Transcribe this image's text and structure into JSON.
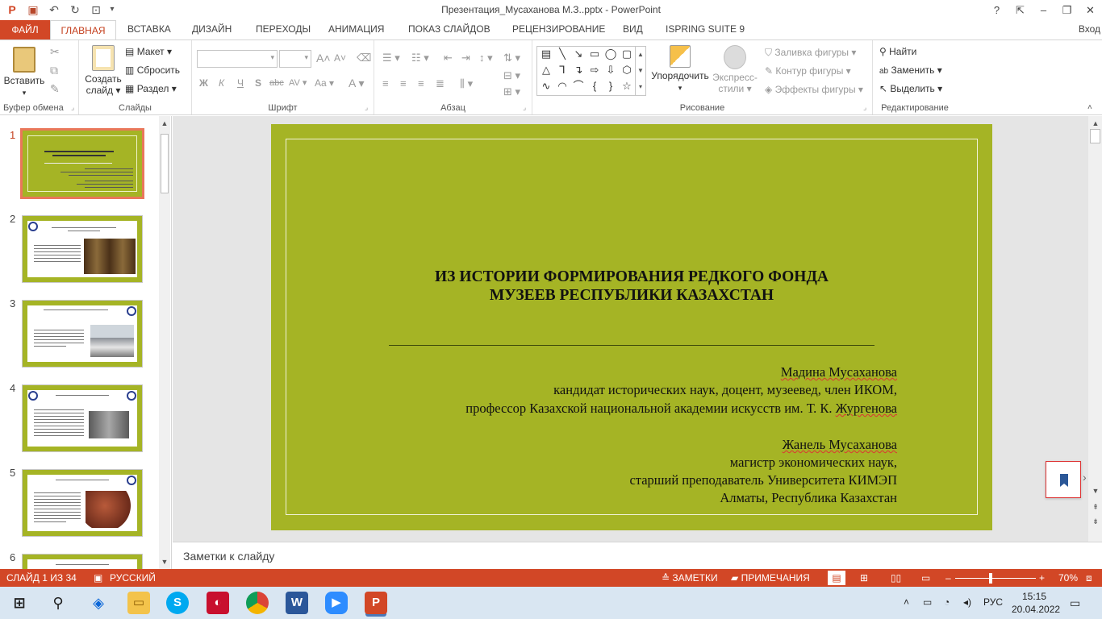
{
  "window": {
    "title": "Презентация_Мусаханова М.З..pptx - PowerPoint",
    "help": "?",
    "controls": [
      "–",
      "❐",
      "✕"
    ]
  },
  "tabs": {
    "file": "ФАЙЛ",
    "active": "ГЛАВНАЯ",
    "others": [
      "ВСТАВКА",
      "ДИЗАЙН",
      "ПЕРЕХОДЫ",
      "АНИМАЦИЯ",
      "ПОКАЗ СЛАЙДОВ",
      "РЕЦЕНЗИРОВАНИЕ",
      "ВИД",
      "ISPRING SUITE 9"
    ],
    "login": "Вход"
  },
  "ribbon": {
    "clipboard": {
      "label": "Буфер обмена",
      "paste": "Вставить"
    },
    "slides": {
      "label": "Слайды",
      "new_slide_1": "Создать",
      "new_slide_2": "слайд",
      "layout": "Макет",
      "reset": "Сбросить",
      "section": "Раздел"
    },
    "font": {
      "label": "Шрифт",
      "bold": "Ж",
      "italic": "К",
      "underline": "Ч",
      "shadow": "S",
      "strike": "abc",
      "spacing": "AV",
      "case": "Aa",
      "grow": "A",
      "shrink": "A",
      "color": "A"
    },
    "paragraph": {
      "label": "Абзац"
    },
    "drawing": {
      "label": "Рисование",
      "arrange": "Упорядочить",
      "styles_1": "Экспресс-",
      "styles_2": "стили",
      "fill": "Заливка фигуры",
      "outline": "Контур фигуры",
      "effects": "Эффекты фигуры"
    },
    "editing": {
      "label": "Редактирование",
      "find": "Найти",
      "replace": "Заменить",
      "select": "Выделить"
    }
  },
  "thumbnails": {
    "numbers": [
      "1",
      "2",
      "3",
      "4",
      "5",
      "6"
    ]
  },
  "slide": {
    "title_line1": "ИЗ ИСТОРИИ ФОРМИРОВАНИЯ РЕДКОГО ФОНДА",
    "title_line2": "МУЗЕЕВ РЕСПУБЛИКИ КАЗАХСТАН",
    "author1_name": "Мадина Мусаханова",
    "author1_line2": "кандидат исторических наук, доцент, музеевед, член ИКОМ,",
    "author1_line3_a": "профессор Казахской национальной академии искусств им.  Т. К. ",
    "author1_line3_b": "Жургенова",
    "author2_name": "Жанель Мусаханова",
    "author2_line2": "магистр экономических наук,",
    "author2_line3": "старший преподаватель Университета КИМЭП",
    "author2_line4": "Алматы, Республика Казахстан",
    "background": "#a5b425"
  },
  "notes": {
    "placeholder": "Заметки к слайду"
  },
  "status": {
    "slide_counter": "СЛАЙД 1 ИЗ 34",
    "language": "РУССКИЙ",
    "notes": "ЗАМЕТКИ",
    "comments": "ПРИМЕЧАНИЯ",
    "zoom": "70%",
    "minus": "–",
    "plus": "+",
    "zoom_fraction": 0.42
  },
  "taskbar": {
    "time": "15:15",
    "date": "20.04.2022",
    "lang": "РУС"
  },
  "colors": {
    "accent": "#d24726",
    "tab_active": "#c43e1c",
    "slide_green": "#a5b425"
  }
}
